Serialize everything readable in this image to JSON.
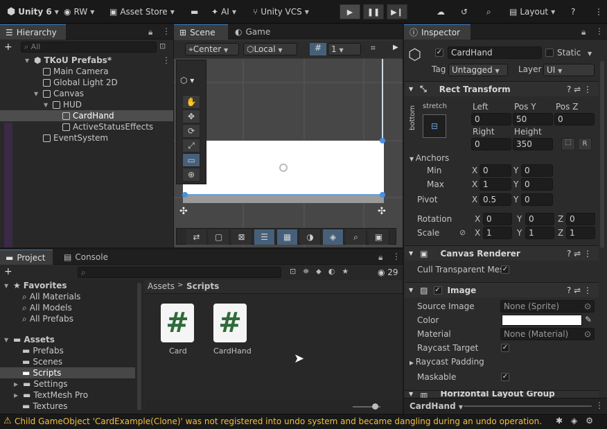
{
  "toolbar": {
    "unity": "Unity 6",
    "account": "RW",
    "asset_store": "Asset Store",
    "ai": "AI",
    "vcs": "Unity VCS",
    "layout": "Layout"
  },
  "hierarchy": {
    "tab": "Hierarchy",
    "search_placeholder": "All",
    "items": [
      "TKoU Prefabs*",
      "Main Camera",
      "Global Light 2D",
      "Canvas",
      "HUD",
      "CardHand",
      "ActiveStatusEffects",
      "EventSystem"
    ]
  },
  "scene": {
    "tab_scene": "Scene",
    "tab_game": "Game",
    "pivot_mode": "Center",
    "space_mode": "Local",
    "grid_value": "1"
  },
  "inspector": {
    "tab": "Inspector",
    "object_name": "CardHand",
    "static_label": "Static",
    "tag_label": "Tag",
    "tag_value": "Untagged",
    "layer_label": "Layer",
    "layer_value": "UI",
    "rect_transform": {
      "title": "Rect Transform",
      "anchor_h": "stretch",
      "anchor_v": "bottom",
      "labels": {
        "left": "Left",
        "posy": "Pos Y",
        "posz": "Pos Z",
        "right": "Right",
        "height": "Height"
      },
      "values": {
        "left": "0",
        "posy": "50",
        "posz": "0",
        "right": "0",
        "height": "350"
      },
      "anchors": "Anchors",
      "min": "Min",
      "max": "Max",
      "min_x": "0",
      "min_y": "0",
      "max_x": "1",
      "max_y": "0",
      "pivot": "Pivot",
      "pivot_x": "0.5",
      "pivot_y": "0",
      "rotation": "Rotation",
      "rot_x": "0",
      "rot_y": "0",
      "rot_z": "0",
      "scale": "Scale",
      "scale_x": "1",
      "scale_y": "1",
      "scale_z": "1",
      "axis_x": "X",
      "axis_y": "Y",
      "axis_z": "Z",
      "r_button": "R"
    },
    "canvas_renderer": {
      "title": "Canvas Renderer",
      "cull": "Cull Transparent Mes"
    },
    "image": {
      "title": "Image",
      "source_label": "Source Image",
      "source_value": "None (Sprite)",
      "color_label": "Color",
      "material_label": "Material",
      "material_value": "None (Material)",
      "raycast_target": "Raycast Target",
      "raycast_padding": "Raycast Padding",
      "maskable": "Maskable"
    },
    "next_component": "Horizontal Layout Group",
    "footer": "CardHand"
  },
  "project": {
    "tab_project": "Project",
    "tab_console": "Console",
    "count": "29",
    "favorites": "Favorites",
    "fav_items": [
      "All Materials",
      "All Models",
      "All Prefabs"
    ],
    "assets": "Assets",
    "asset_items": [
      "Prefabs",
      "Scenes",
      "Scripts",
      "Settings",
      "TextMesh Pro",
      "Textures"
    ],
    "breadcrumb_root": "Assets",
    "breadcrumb_current": "Scripts",
    "files": [
      "Card",
      "CardHand"
    ]
  },
  "status": {
    "message": "Child GameObject 'CardExample(Clone)' was not registered into undo system and became dangling during an undo operation."
  },
  "colors": {
    "accent": "#3a79bb",
    "warning": "#f0c040",
    "script_green": "#2f6b3a"
  }
}
